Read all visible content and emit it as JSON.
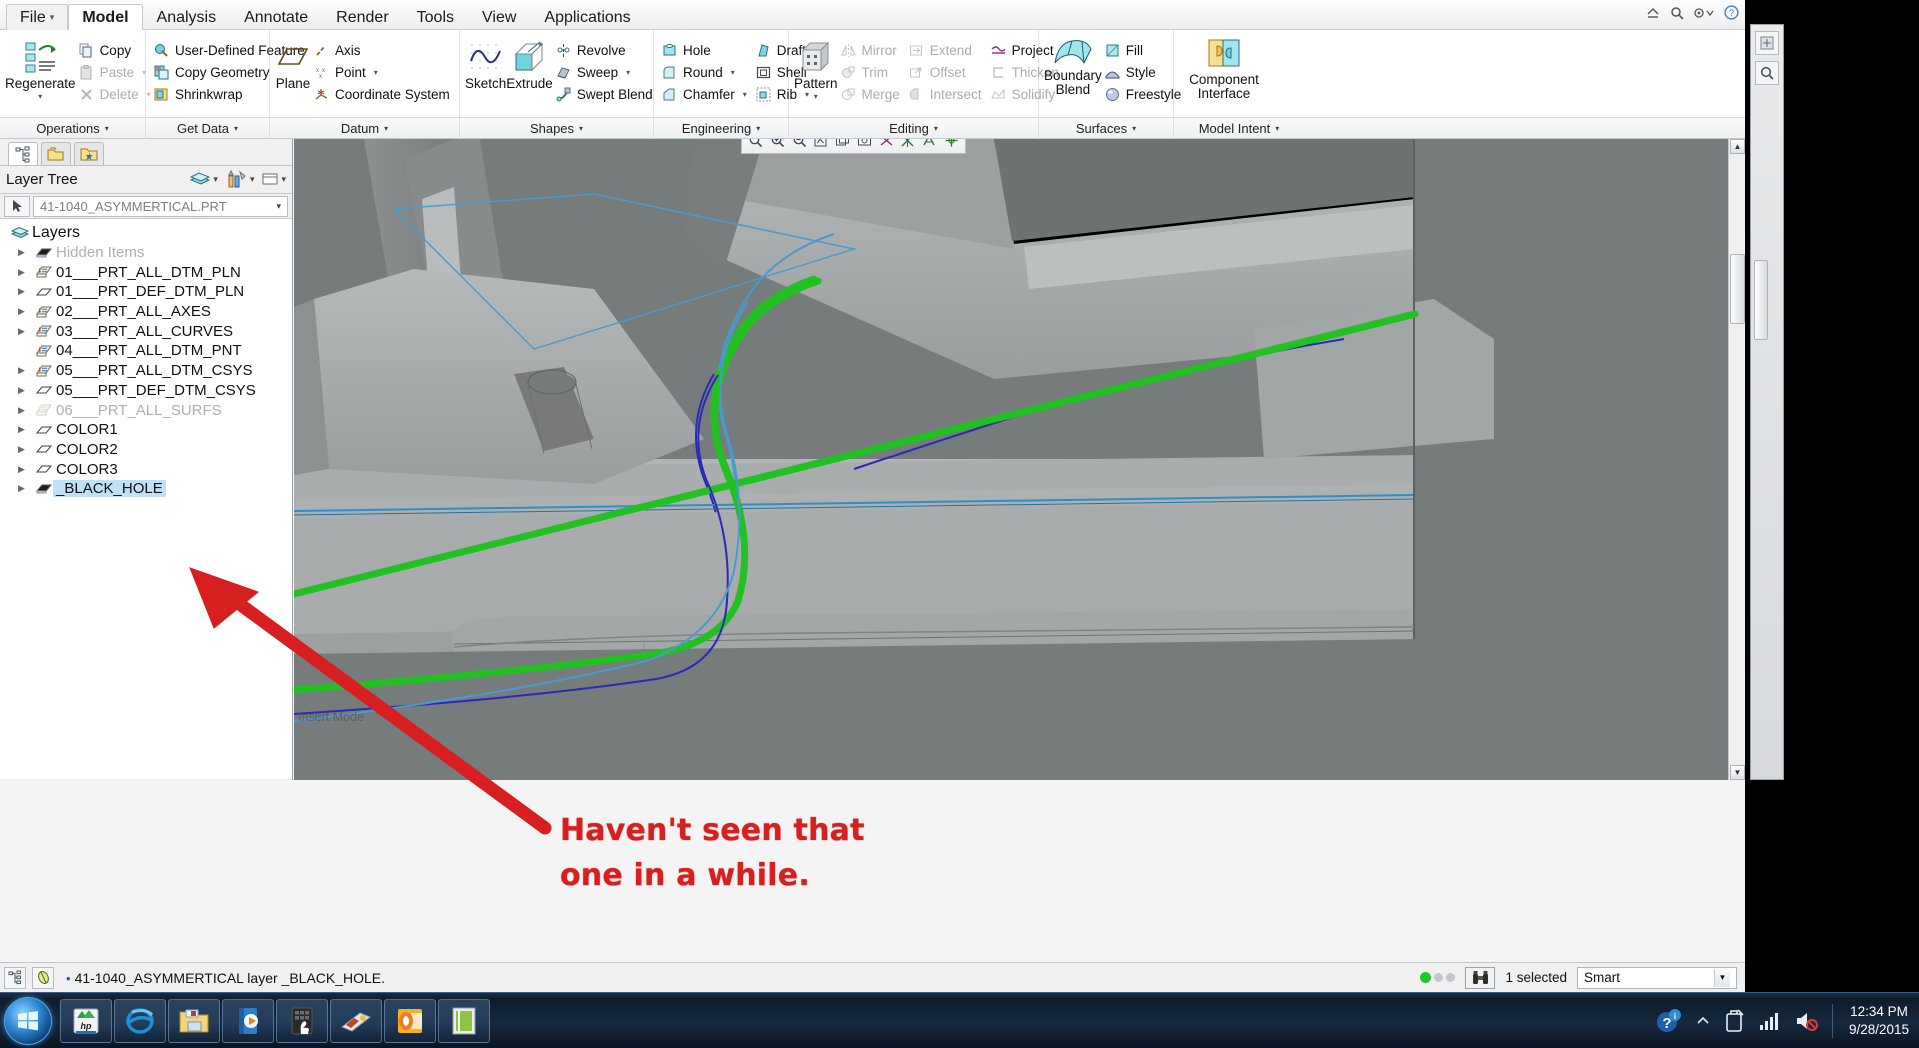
{
  "window": {
    "title_controls": [
      "minimize",
      "search",
      "options",
      "help"
    ]
  },
  "ribbon": {
    "tabs": [
      {
        "label": "File",
        "has_caret": true,
        "active": false
      },
      {
        "label": "Model",
        "has_caret": false,
        "active": true
      },
      {
        "label": "Analysis",
        "has_caret": false,
        "active": false
      },
      {
        "label": "Annotate",
        "has_caret": false,
        "active": false
      },
      {
        "label": "Render",
        "has_caret": false,
        "active": false
      },
      {
        "label": "Tools",
        "has_caret": false,
        "active": false
      },
      {
        "label": "View",
        "has_caret": false,
        "active": false
      },
      {
        "label": "Applications",
        "has_caret": false,
        "active": false
      }
    ],
    "groups": [
      {
        "title": "Operations",
        "big": [
          {
            "label": "Regenerate",
            "icon": "regenerate-icon",
            "dropdown": true
          }
        ],
        "items": [
          {
            "label": "Copy",
            "icon": "copy-icon",
            "disabled": false,
            "dropdown": false
          },
          {
            "label": "Paste",
            "icon": "paste-icon",
            "disabled": true,
            "dropdown": true
          },
          {
            "label": "Delete",
            "icon": "delete-icon",
            "disabled": true,
            "dropdown": true
          }
        ]
      },
      {
        "title": "Get Data",
        "big": [],
        "items": [
          {
            "label": "User-Defined Feature",
            "icon": "udf-icon",
            "disabled": false,
            "dropdown": false
          },
          {
            "label": "Copy Geometry",
            "icon": "copy-geometry-icon",
            "disabled": false,
            "dropdown": false
          },
          {
            "label": "Shrinkwrap",
            "icon": "shrinkwrap-icon",
            "disabled": false,
            "dropdown": false
          }
        ]
      },
      {
        "title": "Datum",
        "big": [
          {
            "label": "Plane",
            "icon": "plane-icon",
            "dropdown": false
          }
        ],
        "items": [
          {
            "label": "Axis",
            "icon": "axis-icon",
            "disabled": false,
            "dropdown": false
          },
          {
            "label": "Point",
            "icon": "point-icon",
            "disabled": false,
            "dropdown": true
          },
          {
            "label": "Coordinate System",
            "icon": "coordinate-system-icon",
            "disabled": false,
            "dropdown": false
          }
        ]
      },
      {
        "title": "Shapes",
        "big": [
          {
            "label": "Sketch",
            "icon": "sketch-icon",
            "dropdown": false
          },
          {
            "label": "Extrude",
            "icon": "extrude-icon",
            "dropdown": false
          }
        ],
        "items": [
          {
            "label": "Revolve",
            "icon": "revolve-icon",
            "disabled": false,
            "dropdown": false
          },
          {
            "label": "Sweep",
            "icon": "sweep-icon",
            "disabled": false,
            "dropdown": true
          },
          {
            "label": "Swept Blend",
            "icon": "swept-blend-icon",
            "disabled": false,
            "dropdown": false
          }
        ]
      },
      {
        "title": "Engineering",
        "big": [],
        "items": [
          {
            "label": "Hole",
            "icon": "hole-icon",
            "disabled": false,
            "dropdown": false
          },
          {
            "label": "Round",
            "icon": "round-icon",
            "disabled": false,
            "dropdown": true
          },
          {
            "label": "Chamfer",
            "icon": "chamfer-icon",
            "disabled": false,
            "dropdown": true
          },
          {
            "label": "Draft",
            "icon": "draft-icon",
            "disabled": false,
            "dropdown": true
          },
          {
            "label": "Shell",
            "icon": "shell-icon",
            "disabled": false,
            "dropdown": false
          },
          {
            "label": "Rib",
            "icon": "rib-icon",
            "disabled": false,
            "dropdown": true
          }
        ]
      },
      {
        "title": "Editing",
        "big": [
          {
            "label": "Pattern",
            "icon": "pattern-icon",
            "dropdown": true
          }
        ],
        "items": [
          {
            "label": "Mirror",
            "icon": "mirror-icon",
            "disabled": true,
            "dropdown": false
          },
          {
            "label": "Trim",
            "icon": "trim-icon",
            "disabled": true,
            "dropdown": false
          },
          {
            "label": "Merge",
            "icon": "merge-icon",
            "disabled": true,
            "dropdown": false
          },
          {
            "label": "Extend",
            "icon": "extend-icon",
            "disabled": true,
            "dropdown": false
          },
          {
            "label": "Offset",
            "icon": "offset-icon",
            "disabled": true,
            "dropdown": false
          },
          {
            "label": "Intersect",
            "icon": "intersect-icon",
            "disabled": true,
            "dropdown": false
          },
          {
            "label": "Project",
            "icon": "project-icon",
            "disabled": false,
            "dropdown": false
          },
          {
            "label": "Thicken",
            "icon": "thicken-icon",
            "disabled": true,
            "dropdown": false
          },
          {
            "label": "Solidify",
            "icon": "solidify-icon",
            "disabled": true,
            "dropdown": false
          }
        ]
      },
      {
        "title": "Surfaces",
        "big": [
          {
            "label": "Boundary Blend",
            "icon": "boundary-blend-icon",
            "dropdown": false
          }
        ],
        "items": [
          {
            "label": "Fill",
            "icon": "fill-icon",
            "disabled": false,
            "dropdown": false
          },
          {
            "label": "Style",
            "icon": "style-icon",
            "disabled": false,
            "dropdown": false
          },
          {
            "label": "Freestyle",
            "icon": "freestyle-icon",
            "disabled": false,
            "dropdown": false
          }
        ]
      },
      {
        "title": "Model Intent",
        "big": [
          {
            "label": "Component Interface",
            "icon": "component-interface-icon",
            "dropdown": false
          }
        ],
        "items": []
      }
    ]
  },
  "left_panel": {
    "tabs": [
      "model-tree-icon",
      "folder-browser-icon",
      "favorites-icon"
    ],
    "header_title": "Layer Tree",
    "header_icons": [
      "layers-icon",
      "chevron-down-icon",
      "settings-tools-icon",
      "display-icon",
      "chevron-down-icon"
    ],
    "filter": {
      "value": "41-1040_ASYMMERTICAL.PRT",
      "arrow_icon": "pointer-icon"
    },
    "tree": [
      {
        "label": "Layers",
        "icon": "layers-icon",
        "expandable": false,
        "indent": 0,
        "dimmed": false,
        "selected": false,
        "root": true
      },
      {
        "label": "Hidden Items",
        "icon": "hidden-layer-icon",
        "expandable": true,
        "indent": 1,
        "dimmed": true,
        "selected": false
      },
      {
        "label": "01___PRT_ALL_DTM_PLN",
        "icon": "layer-icon",
        "expandable": true,
        "indent": 1,
        "dimmed": false,
        "selected": false
      },
      {
        "label": "01___PRT_DEF_DTM_PLN",
        "icon": "plane-layer-icon",
        "expandable": true,
        "indent": 1,
        "dimmed": false,
        "selected": false
      },
      {
        "label": "02___PRT_ALL_AXES",
        "icon": "layer-icon",
        "expandable": true,
        "indent": 1,
        "dimmed": false,
        "selected": false
      },
      {
        "label": "03___PRT_ALL_CURVES",
        "icon": "layer-icon",
        "expandable": true,
        "indent": 1,
        "dimmed": false,
        "selected": false
      },
      {
        "label": "04___PRT_ALL_DTM_PNT",
        "icon": "layer-icon",
        "expandable": false,
        "indent": 1,
        "dimmed": false,
        "selected": false
      },
      {
        "label": "05___PRT_ALL_DTM_CSYS",
        "icon": "layer-icon",
        "expandable": true,
        "indent": 1,
        "dimmed": false,
        "selected": false
      },
      {
        "label": "05___PRT_DEF_DTM_CSYS",
        "icon": "plane-layer-icon",
        "expandable": true,
        "indent": 1,
        "dimmed": false,
        "selected": false
      },
      {
        "label": "06___PRT_ALL_SURFS",
        "icon": "layer-icon",
        "expandable": true,
        "indent": 1,
        "dimmed": true,
        "selected": false
      },
      {
        "label": "COLOR1",
        "icon": "plane-layer-icon",
        "expandable": true,
        "indent": 1,
        "dimmed": false,
        "selected": false
      },
      {
        "label": "COLOR2",
        "icon": "plane-layer-icon",
        "expandable": true,
        "indent": 1,
        "dimmed": false,
        "selected": false
      },
      {
        "label": "COLOR3",
        "icon": "plane-layer-icon",
        "expandable": true,
        "indent": 1,
        "dimmed": false,
        "selected": false
      },
      {
        "label": "_BLACK_HOLE",
        "icon": "hidden-layer-icon",
        "expandable": true,
        "indent": 1,
        "dimmed": false,
        "selected": true
      }
    ]
  },
  "graphics": {
    "toolbar_icons": [
      "zoom-fit-icon",
      "zoom-in-icon",
      "zoom-out-icon",
      "repaint-icon",
      "display-style-icon",
      "saved-views-icon",
      "perspective-icon",
      "datum-display-icon",
      "annotation-display-icon",
      "spin-center-icon"
    ],
    "insert_mode_label": "Insert Mode",
    "background_color": "#767b7c",
    "model_color": "#a6a8a9",
    "curve_green": "#22c022",
    "curve_blue": "#2a2ab5",
    "curve_cyan": "#4a9ad0"
  },
  "status_bar": {
    "icons": [
      "model-tree-icon",
      "globe-icon"
    ],
    "message": "41-1040_ASYMMERTICAL layer _BLACK_HOLE.",
    "selection_count": "1 selected",
    "filter_value": "Smart",
    "search_icon": "binoculars-icon"
  },
  "annotation": {
    "line1": "Haven't seen that",
    "line2": "one in a while.",
    "color": "#d81f1f",
    "arrow": "red-arrow-pointing-to-black-hole-layer"
  },
  "taskbar": {
    "start_button": "windows-start-orb",
    "items": [
      "hp-support-icon",
      "internet-explorer-icon",
      "windows-explorer-icon",
      "media-player-icon",
      "calculator-icon",
      "photo-viewer-icon",
      "outlook-icon",
      "creo-icon"
    ],
    "tray": {
      "icons": [
        "action-center-help-icon",
        "show-hidden-icon",
        "removable-media-icon",
        "network-icon",
        "volume-muted-icon"
      ],
      "time": "12:34 PM",
      "date": "9/28/2015"
    }
  }
}
